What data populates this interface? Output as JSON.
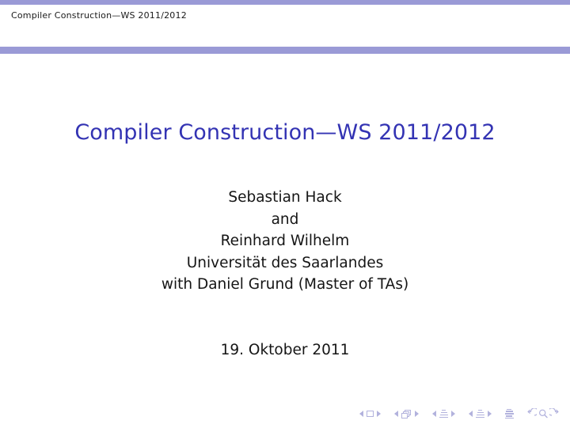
{
  "slide": {
    "headline": "Compiler Construction—WS 2011/2012",
    "title": "Compiler Construction—WS 2011/2012",
    "authors": [
      "Sebastian Hack",
      "and",
      "Reinhard Wilhelm",
      "Universität des Saarlandes",
      "with Daniel Grund (Master of TAs)"
    ],
    "date": "19. Oktober 2011"
  },
  "theme": {
    "bar_color": "#9a9ad6",
    "title_color": "#3333b3",
    "text_color": "#151515",
    "nav_color": "#b2b2dd",
    "background": "#ffffff"
  },
  "navigation": {
    "items": [
      {
        "name": "previous-slide",
        "glyph": "left-triangle"
      },
      {
        "name": "slide-indicator",
        "glyph": "square"
      },
      {
        "name": "next-slide",
        "glyph": "right-triangle"
      },
      {
        "name": "previous-frame",
        "glyph": "left-triangle"
      },
      {
        "name": "frame-indicator",
        "glyph": "stacked-squares"
      },
      {
        "name": "next-frame",
        "glyph": "right-triangle"
      },
      {
        "name": "previous-subsection",
        "glyph": "left-triangle"
      },
      {
        "name": "subsection-indicator",
        "glyph": "lines"
      },
      {
        "name": "next-subsection",
        "glyph": "right-triangle"
      },
      {
        "name": "previous-section",
        "glyph": "left-triangle"
      },
      {
        "name": "section-indicator",
        "glyph": "lines"
      },
      {
        "name": "next-section",
        "glyph": "right-triangle"
      },
      {
        "name": "document-indicator",
        "glyph": "document-lines"
      },
      {
        "name": "back-button",
        "glyph": "back-arrow"
      },
      {
        "name": "find-button",
        "glyph": "magnifier"
      },
      {
        "name": "forward-button",
        "glyph": "forward-arrow"
      }
    ]
  }
}
